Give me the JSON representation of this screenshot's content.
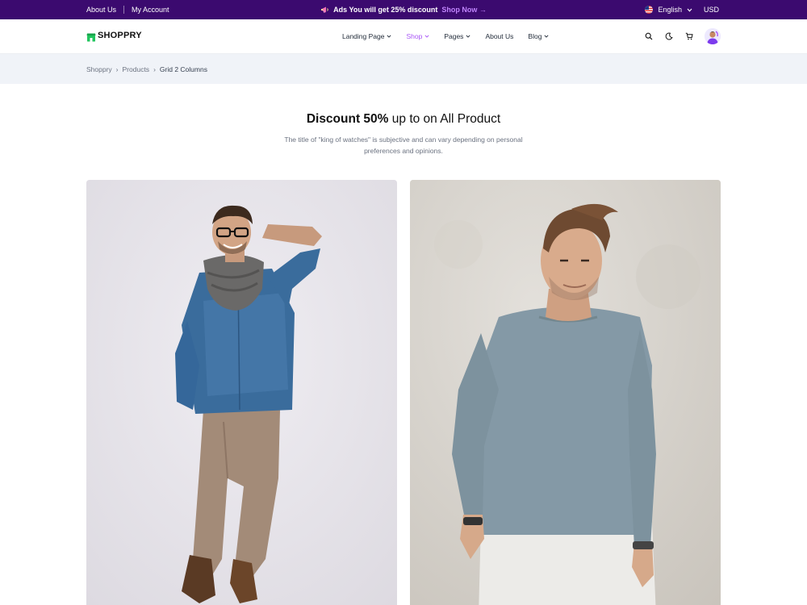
{
  "topbar": {
    "about_us": "About Us",
    "my_account": "My Account",
    "promo_text": "Ads You will get 25% discount",
    "shop_now": "Shop Now →",
    "language": "English",
    "currency": "USD"
  },
  "header": {
    "logo": "SHOPPRY",
    "nav": [
      {
        "label": "Landing Page",
        "has_dropdown": true
      },
      {
        "label": "Shop",
        "has_dropdown": true,
        "active": true
      },
      {
        "label": "Pages",
        "has_dropdown": true
      },
      {
        "label": "About Us",
        "has_dropdown": false
      },
      {
        "label": "Blog",
        "has_dropdown": true
      }
    ],
    "icons": [
      "search-icon",
      "moon-icon",
      "cart-icon",
      "avatar"
    ]
  },
  "breadcrumb": {
    "items": [
      "Shoppry",
      "Products"
    ],
    "current": "Grid 2 Columns",
    "separator": "›"
  },
  "hero": {
    "title_strong": "Discount 50%",
    "title_rest": "up to on All Product",
    "description": "The title of \"king of watches\" is subjective and can vary depending on personal preferences and opinions."
  },
  "products": [
    {
      "image": "man-denim-shirt-scarf-photo"
    },
    {
      "image": "man-gray-long-sleeve-photo"
    }
  ],
  "colors": {
    "topbar_bg": "#3b0a6f",
    "accent": "#a855f7",
    "promo_link": "#c084fc",
    "breadcrumb_bg": "#f0f3f8",
    "logo_green": "#22c55e"
  }
}
